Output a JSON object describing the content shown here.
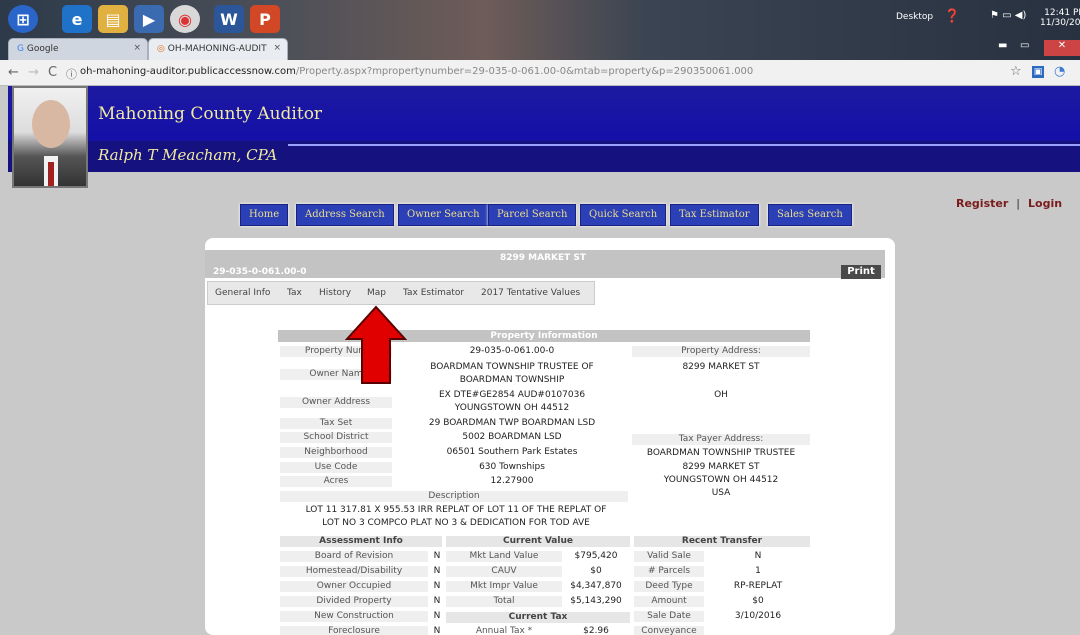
{
  "browser": {
    "tabs": [
      {
        "label": "Google",
        "close": "×"
      },
      {
        "label": "OH-MAHONING-AUDIT",
        "close": "×"
      }
    ],
    "url_domain": "oh-mahoning-auditor.publicaccessnow.com",
    "url_path": "/Property.aspx?mpropertynumber=29-035-0-061.00-0&mtab=property&p=290350061.000",
    "tray": {
      "desktop": "Desktop",
      "time": "12:41 PM",
      "date": "11/30/201"
    }
  },
  "header": {
    "title": "Mahoning County Auditor",
    "official": "Ralph T Meacham, CPA"
  },
  "nav_buttons": [
    "Home",
    "Address Search",
    "Owner Search",
    "Parcel Search",
    "Quick Search",
    "Tax Estimator",
    "Sales Search"
  ],
  "auth": {
    "register": "Register",
    "separator": "|",
    "login": "Login"
  },
  "property": {
    "address_title": "8299 MARKET ST",
    "parcel_number": "29-035-0-061.00-0",
    "print_label": "Print",
    "tabs": [
      "General Info",
      "Tax",
      "History",
      "Map",
      "Tax Estimator",
      "2017 Tentative Values"
    ],
    "section_title": "Property Information",
    "labels": {
      "property_number": "Property Num",
      "owner_name": "Owner Nam",
      "owner_address": "Owner Address",
      "tax_set": "Tax Set",
      "school_district": "School District",
      "neighborhood": "Neighborhood",
      "use_code": "Use Code",
      "acres": "Acres",
      "description": "Description",
      "property_address": "Property Address:",
      "tax_payer_address": "Tax Payer Address:"
    },
    "values": {
      "property_number": "29-035-0-061.00-0",
      "owner_name_1": "BOARDMAN TOWNSHIP TRUSTEE OF",
      "owner_name_2": "BOARDMAN TOWNSHIP",
      "owner_address_1": "EX DTE#GE2854 AUD#0107036",
      "owner_address_2": "YOUNGSTOWN OH 44512",
      "tax_set": "29 BOARDMAN TWP BOARDMAN LSD",
      "school_district": "5002 BOARDMAN LSD",
      "neighborhood": "06501 Southern Park Estates",
      "use_code": "630 Townships",
      "acres": "12.27900",
      "description_1": "LOT 11 317.81 X 955.53 IRR REPLAT OF LOT 11 OF THE REPLAT OF",
      "description_2": "LOT NO 3 COMPCO PLAT NO 3 & DEDICATION FOR TOD AVE",
      "property_address_1": "8299 MARKET ST",
      "property_address_2": "OH",
      "tax_payer_1": "BOARDMAN TOWNSHIP TRUSTEE",
      "tax_payer_2": "8299 MARKET ST",
      "tax_payer_3": "YOUNGSTOWN OH 44512",
      "tax_payer_4": "USA"
    },
    "assessment": {
      "title": "Assessment Info",
      "rows": [
        {
          "label": "Board of Revision",
          "value": "N"
        },
        {
          "label": "Homestead/Disability",
          "value": "N"
        },
        {
          "label": "Owner Occupied",
          "value": "N"
        },
        {
          "label": "Divided Property",
          "value": "N"
        },
        {
          "label": "New Construction",
          "value": "N"
        },
        {
          "label": "Foreclosure",
          "value": "N"
        }
      ]
    },
    "current_value": {
      "title": "Current Value",
      "rows": [
        {
          "label": "Mkt Land Value",
          "value": "$795,420"
        },
        {
          "label": "CAUV",
          "value": "$0"
        },
        {
          "label": "Mkt Impr Value",
          "value": "$4,347,870"
        },
        {
          "label": "Total",
          "value": "$5,143,290"
        }
      ]
    },
    "current_tax": {
      "title": "Current Tax",
      "rows": [
        {
          "label": "Annual Tax *",
          "value": "$2.96"
        }
      ]
    },
    "recent_transfer": {
      "title": "Recent Transfer",
      "rows": [
        {
          "label": "Valid Sale",
          "value": "N"
        },
        {
          "label": "# Parcels",
          "value": "1"
        },
        {
          "label": "Deed Type",
          "value": "RP-REPLAT"
        },
        {
          "label": "Amount",
          "value": "$0"
        },
        {
          "label": "Sale Date",
          "value": "3/10/2016"
        },
        {
          "label": "Conveyance",
          "value": ""
        }
      ]
    }
  },
  "colors": {
    "header_blue": "#1410a8",
    "nav_button": "#2b3fb7",
    "nav_text": "#ecdf8a",
    "header_text": "#f0e9a0",
    "arrow": "#e00000",
    "login": "#7a1c1c"
  }
}
